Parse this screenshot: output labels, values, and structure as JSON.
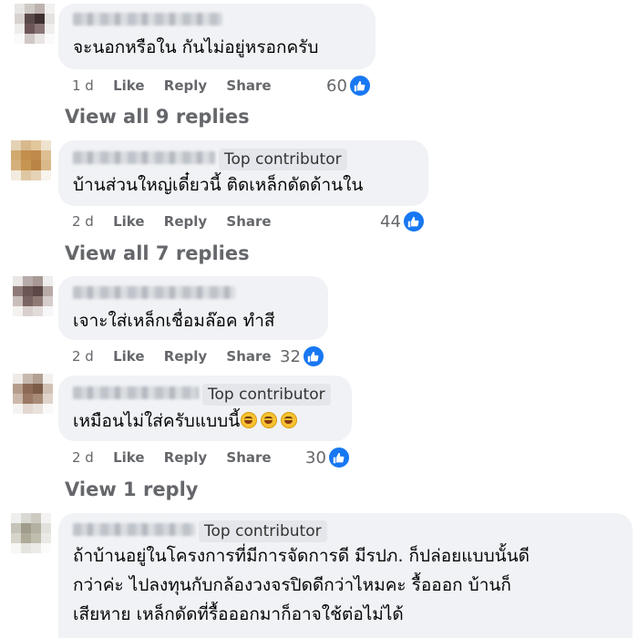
{
  "comments": [
    {
      "text": [
        "จะนอกหรือใน กันไม่อยู่หรอกครับ"
      ],
      "badge": null,
      "time": "1 d",
      "like": "Like",
      "reply": "Reply",
      "share": "Share",
      "reactions": "60",
      "view_replies": "View all 9 replies"
    },
    {
      "text": [
        "บ้านส่วนใหญ่เดี๋ยวนี้ ติดเหล็กดัดด้านใน"
      ],
      "badge": "Top contributor",
      "time": "2 d",
      "like": "Like",
      "reply": "Reply",
      "share": "Share",
      "reactions": "44",
      "view_replies": "View all 7 replies"
    },
    {
      "text": [
        "เจาะใส่เหล็กเชื่อมล๊อค ทำสี"
      ],
      "badge": null,
      "time": "2 d",
      "like": "Like",
      "reply": "Reply",
      "share": "Share",
      "reactions": "32",
      "view_replies": null
    },
    {
      "text": [
        "เหมือนไม่ใส่ครับแบบนี้"
      ],
      "badge": "Top contributor",
      "time": "2 d",
      "like": "Like",
      "reply": "Reply",
      "share": "Share",
      "reactions": "30",
      "view_replies": "View 1 reply"
    },
    {
      "text": [
        "ถ้าบ้านอยู่ในโครงการที่มีการจัดการดี มีรปภ. ก็ปล่อยแบบนั้นดี",
        "กว่าค่ะ ไปลงทุนกับกล้องวงจรปิดดีกว่าไหมคะ รื้อออก บ้านก็",
        "เสียหาย เหล็กดัดที่รื้อออกมาก็อาจใช้ต่อไม่ได้"
      ],
      "badge": "Top contributor",
      "time": null,
      "reactions": null,
      "view_replies": null
    }
  ],
  "colors": {
    "bubble": "#f0f2f5",
    "meta": "#65676b",
    "like_blue": "#1877f2"
  }
}
